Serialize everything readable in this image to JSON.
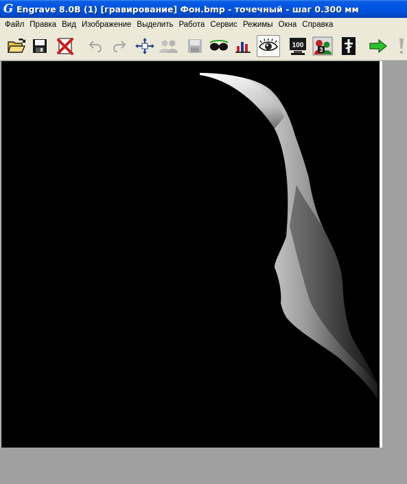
{
  "window": {
    "icon_letter": "G",
    "title": "Engrave 8.0B (1) [гравирование] Фон.bmp - точечный - шаг 0.300 мм"
  },
  "menu": [
    "Файл",
    "Правка",
    "Вид",
    "Изображение",
    "Выделить",
    "Работа",
    "Сервис",
    "Режимы",
    "Окна",
    "Справка"
  ],
  "toolbar": {
    "buttons": [
      {
        "icon": "open-folder-icon"
      },
      {
        "icon": "save-disk-icon"
      },
      {
        "icon": "close-red-x-icon"
      },
      {
        "icon": "undo-icon",
        "disabled": true
      },
      {
        "icon": "redo-icon",
        "disabled": true
      },
      {
        "icon": "move-arrows-icon"
      },
      {
        "icon": "users-icon",
        "disabled": true
      },
      {
        "icon": "save-disabled-icon",
        "disabled": true
      },
      {
        "icon": "sunglasses-icon"
      },
      {
        "icon": "bar-chart-icon"
      },
      {
        "icon": "eye-icon",
        "pressed": true
      },
      {
        "icon": "monitor-100-icon",
        "label": "100"
      },
      {
        "icon": "faces-3-icon",
        "label": "3"
      },
      {
        "icon": "cross-icon"
      },
      {
        "icon": "green-arrow-icon"
      },
      {
        "icon": "exclamation-icon",
        "disabled": true
      }
    ],
    "monitor_label": "100",
    "faces_label": "3"
  },
  "colors": {
    "title_bar": "#0054e3",
    "chrome": "#ece9d8",
    "workspace": "#a0a0a0",
    "image_background": "#000000"
  }
}
